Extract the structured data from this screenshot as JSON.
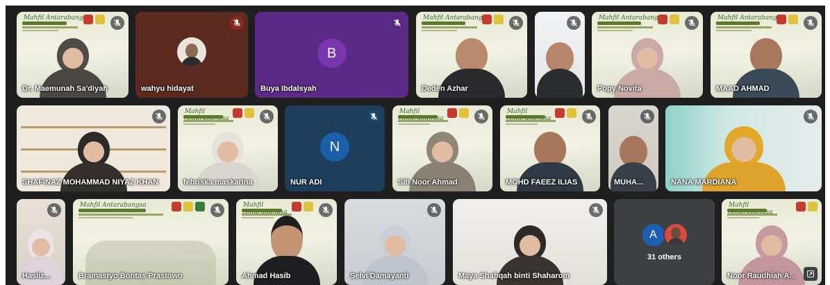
{
  "meeting": {
    "participants": [
      {
        "name": "Dr. Maemunah Sa'diyah",
        "mic": "muted",
        "avatar": "video"
      },
      {
        "name": "wahyu hidayat",
        "mic": "muted-red",
        "avatar": "photo"
      },
      {
        "name": "Buya Ibdalsyah",
        "mic": "muted",
        "avatar": "letter",
        "letter": "B",
        "color": "#5b2a86"
      },
      {
        "name": "Deden Azhar",
        "mic": "muted",
        "avatar": "video"
      },
      {
        "name": "",
        "mic": "muted",
        "avatar": "video"
      },
      {
        "name": "Popy Novita",
        "mic": "muted",
        "avatar": "video"
      },
      {
        "name": "MAAD AHMAD",
        "mic": "muted",
        "avatar": "video"
      },
      {
        "name": "SHAFINAZ MOHAMMAD NIYAZ KHAN",
        "mic": "muted",
        "avatar": "video"
      },
      {
        "name": "febriska maskarina",
        "mic": "muted",
        "avatar": "video"
      },
      {
        "name": "NUR ADI",
        "mic": "muted",
        "avatar": "letter",
        "letter": "N",
        "color": "#1a5fa8"
      },
      {
        "name": "Siti Noor Ahmad",
        "mic": "muted",
        "avatar": "video"
      },
      {
        "name": "MOHD FAEEZ ILIAS",
        "mic": "muted",
        "avatar": "video"
      },
      {
        "name": "MUHA...",
        "mic": "muted",
        "avatar": "video"
      },
      {
        "name": "NANA MARDIANA",
        "mic": "muted",
        "avatar": "video"
      },
      {
        "name": "Hasliz...",
        "mic": "muted",
        "avatar": "video"
      },
      {
        "name": "Bramastyo Bontas Prastowo",
        "mic": "muted",
        "avatar": "video"
      },
      {
        "name": "Ahmad Hasib",
        "mic": "muted",
        "avatar": "video"
      },
      {
        "name": "Selvi Damayanti",
        "mic": "muted",
        "avatar": "video"
      },
      {
        "name": "Maya Shafiqah binti Shaharom",
        "mic": "muted",
        "avatar": "video"
      },
      {
        "name": "Noor Raudhiah A...",
        "mic": "none",
        "avatar": "video"
      }
    ],
    "others": {
      "label": "31 others",
      "letter": "A"
    },
    "banner": {
      "title": "Mahfil Antarabangsa"
    },
    "colors": {
      "stage": "#1f1f1f",
      "tile": "#3c4043",
      "mute_red": "#8b2a23"
    }
  }
}
